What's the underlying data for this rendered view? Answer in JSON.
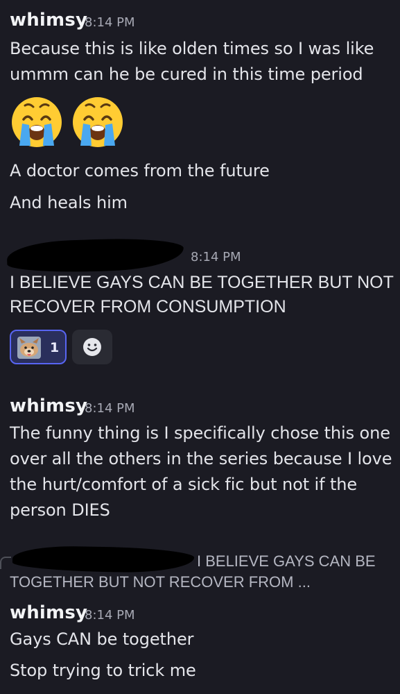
{
  "messages": [
    {
      "author": "whimsy",
      "time": "8:14 PM",
      "lines": [
        "Because this is like olden times so I was like",
        "ummm can he be cured in this time period"
      ],
      "emoji": [
        "loudly-crying-face",
        "loudly-crying-face"
      ],
      "extra": [
        "A doctor comes from the future",
        "And heals him"
      ]
    },
    {
      "author": "",
      "time": "8:14 PM",
      "lines": [
        "I BELIEVE GAYS CAN BE TOGETHER BUT NOT",
        "RECOVER FROM CONSUMPTION"
      ],
      "reactions": [
        {
          "icon": "dog-sticker",
          "count": "1"
        },
        {
          "icon": "add-reaction-smiley"
        }
      ]
    },
    {
      "author": "whimsy",
      "time": "8:14 PM",
      "lines": [
        "The funny thing is I specifically chose this one",
        "over all the others in the series because I love",
        "the hurt/comfort of a sick fic but not if the",
        "person DIES"
      ]
    },
    {
      "reply": {
        "line1": "I BELIEVE GAYS CAN BE",
        "line2": "TOGETHER BUT NOT RECOVER FROM ..."
      },
      "author": "whimsy",
      "time": "8:14 PM",
      "lines": [
        "Gays CAN be together",
        "Stop trying to trick me"
      ]
    }
  ],
  "colors": {
    "background": "#1b1b23",
    "username": "#f2f3f5",
    "timestamp": "#a7a9b4",
    "text": "#e4e5ea",
    "reaction_active_border": "#5865f2",
    "emoji_yellow": "#ffcc33",
    "emoji_tears": "#4aa8f0"
  }
}
